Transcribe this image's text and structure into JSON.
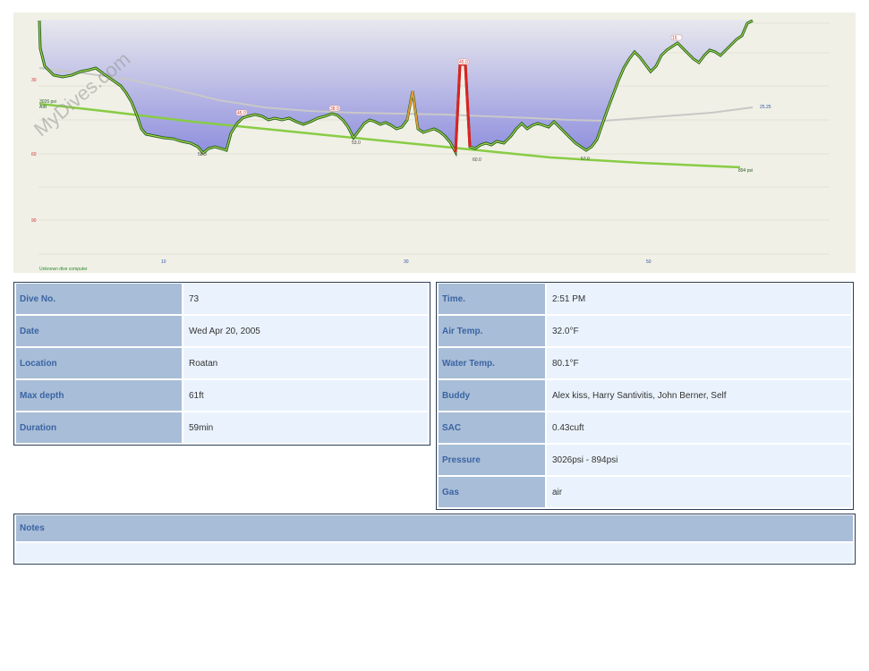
{
  "profile": {
    "watermark": "MyDives.com",
    "depth_ticks": [
      "30",
      "60",
      "90"
    ],
    "time_ticks": [
      "10",
      "30",
      "50"
    ],
    "dive_computer": "Unknown dive computer",
    "gas_start_pressure": "3026 psi",
    "gas_start_name": "AIR",
    "gas_end_pressure": "894 psi",
    "temp_end": "25.25",
    "depth_labels": [
      "58.3",
      "53.0",
      "60.0",
      "57.0"
    ],
    "event_labels": [
      "45.0",
      "38.9",
      "45.0",
      "15"
    ],
    "colors": {
      "background": "#f0f0e6",
      "fill_top": "#e8e8ee",
      "fill_bottom": "#8f8fde",
      "pressure_line": "#88cc44",
      "temperature_line": "#c8c8c8",
      "profile_dark": "#1e5a1e",
      "ascent_warning": "#dd2222",
      "ascent_mid": "#e89a30"
    }
  },
  "dive": {
    "labels": {
      "number": "Dive No.",
      "date": "Date",
      "location": "Location",
      "max_depth": "Max depth",
      "duration": "Duration",
      "time": "Time.",
      "air_temp": "Air Temp.",
      "water_temp": "Water Temp.",
      "buddy": "Buddy",
      "sac": "SAC",
      "pressure": "Pressure",
      "gas": "Gas",
      "notes": "Notes"
    },
    "values": {
      "number": "73",
      "date": "Wed Apr 20, 2005",
      "location": "Roatan",
      "max_depth": "61ft",
      "duration": "59min",
      "time": "2:51 PM",
      "air_temp": "32.0°F",
      "water_temp": "80.1°F",
      "buddy": "Alex kiss, Harry Santivitis, John Berner, Self",
      "sac": "0.43cuft",
      "pressure": "3026psi - 894psi",
      "gas": "air",
      "notes": ""
    }
  }
}
